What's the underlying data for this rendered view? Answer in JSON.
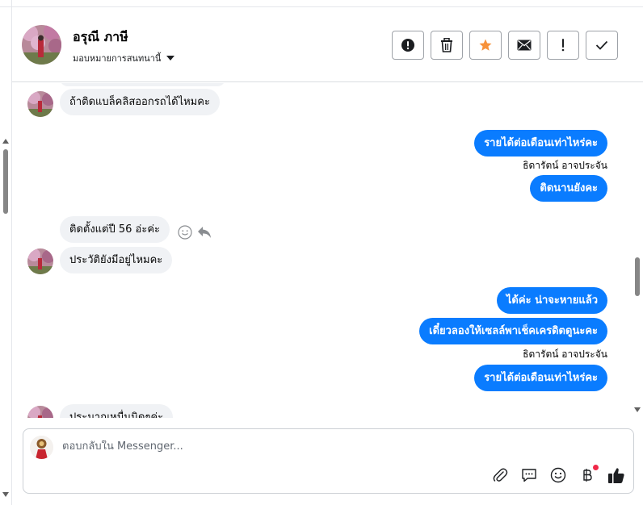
{
  "contact": {
    "name": "อรุณี ภาษี",
    "assign_label": "มอบหมายการสนทนานี้"
  },
  "actions": [
    {
      "name": "spam-button",
      "icon": "alert-circle-icon"
    },
    {
      "name": "delete-button",
      "icon": "trash-icon"
    },
    {
      "name": "star-button",
      "icon": "star-icon",
      "color": "#f7923b"
    },
    {
      "name": "mark-unread-button",
      "icon": "envelope-icon"
    },
    {
      "name": "follow-up-button",
      "icon": "exclamation-icon"
    },
    {
      "name": "done-button",
      "icon": "check-icon"
    }
  ],
  "messages": {
    "m1": "ถ้าติดแบล็คลิสออกรถได้ไหมคะ",
    "m2": "รายได้ต่อเดือนเท่าไหร่คะ",
    "m2_sender": "ธิดารัตน์ อาจประจัน",
    "m3": "ติดนานยังคะ",
    "m4": "ติดตั้งแต่ปี 56 อ่ะค่ะ",
    "m5": "ประวัติยังมีอยู่ไหมคะ",
    "m6": "ได้ค่ะ น่าจะหายแล้ว",
    "m7": "เดี๋ยวลองให้เซลล์พาเช็คเครดิตดูนะคะ",
    "m7_sender": "ธิดารัตน์ อาจประจัน",
    "m8": "รายได้ต่อเดือนเท่าไหร่คะ",
    "m9": "ประมาณหมื่นนิดๆค่ะ"
  },
  "composer": {
    "placeholder": "ตอบกลับใน Messenger..."
  },
  "colors": {
    "outgoing": "#0a7cff",
    "incoming": "#f0f2f5",
    "notification_dot": "#f02849"
  }
}
